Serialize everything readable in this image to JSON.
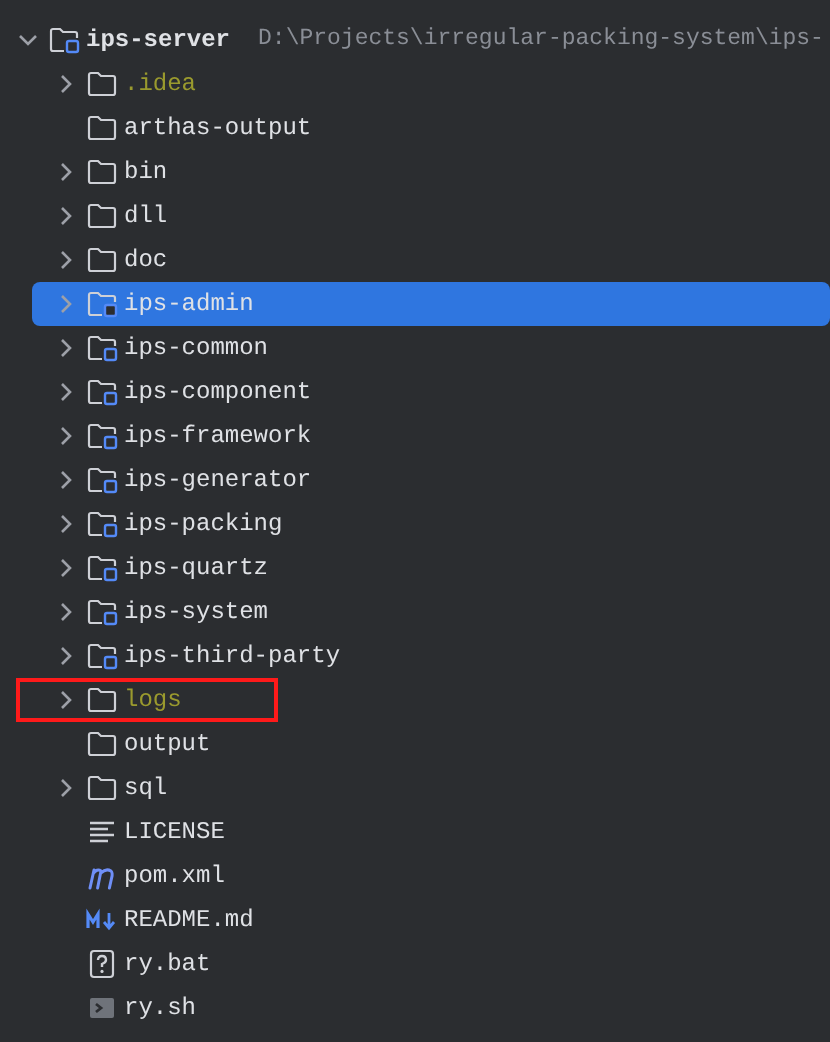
{
  "project_tree": {
    "name": "ips-server",
    "kind": "module",
    "path": "D:\\Projects\\irregular-packing-system\\ips-",
    "expanded": true,
    "children": [
      {
        "name": ".idea",
        "kind": "folder",
        "expandable": true,
        "excluded": true,
        "selected": false,
        "marked": false
      },
      {
        "name": "arthas-output",
        "kind": "folder",
        "expandable": false,
        "excluded": false,
        "selected": false,
        "marked": false
      },
      {
        "name": "bin",
        "kind": "folder",
        "expandable": true,
        "excluded": false,
        "selected": false,
        "marked": false
      },
      {
        "name": "dll",
        "kind": "folder",
        "expandable": true,
        "excluded": false,
        "selected": false,
        "marked": false
      },
      {
        "name": "doc",
        "kind": "folder",
        "expandable": true,
        "excluded": false,
        "selected": false,
        "marked": false
      },
      {
        "name": "ips-admin",
        "kind": "module",
        "expandable": true,
        "excluded": false,
        "selected": true,
        "marked": false
      },
      {
        "name": "ips-common",
        "kind": "module",
        "expandable": true,
        "excluded": false,
        "selected": false,
        "marked": false
      },
      {
        "name": "ips-component",
        "kind": "module",
        "expandable": true,
        "excluded": false,
        "selected": false,
        "marked": false
      },
      {
        "name": "ips-framework",
        "kind": "module",
        "expandable": true,
        "excluded": false,
        "selected": false,
        "marked": false
      },
      {
        "name": "ips-generator",
        "kind": "module",
        "expandable": true,
        "excluded": false,
        "selected": false,
        "marked": false
      },
      {
        "name": "ips-packing",
        "kind": "module",
        "expandable": true,
        "excluded": false,
        "selected": false,
        "marked": false
      },
      {
        "name": "ips-quartz",
        "kind": "module",
        "expandable": true,
        "excluded": false,
        "selected": false,
        "marked": false
      },
      {
        "name": "ips-system",
        "kind": "module",
        "expandable": true,
        "excluded": false,
        "selected": false,
        "marked": false
      },
      {
        "name": "ips-third-party",
        "kind": "module",
        "expandable": true,
        "excluded": false,
        "selected": false,
        "marked": false
      },
      {
        "name": "logs",
        "kind": "folder",
        "expandable": true,
        "excluded": true,
        "selected": false,
        "marked": true
      },
      {
        "name": "output",
        "kind": "folder",
        "expandable": false,
        "excluded": false,
        "selected": false,
        "marked": false
      },
      {
        "name": "sql",
        "kind": "folder",
        "expandable": true,
        "excluded": false,
        "selected": false,
        "marked": false
      },
      {
        "name": "LICENSE",
        "kind": "text",
        "expandable": false,
        "excluded": false,
        "selected": false,
        "marked": false
      },
      {
        "name": "pom.xml",
        "kind": "maven",
        "expandable": false,
        "excluded": false,
        "selected": false,
        "marked": false
      },
      {
        "name": "README.md",
        "kind": "markdown",
        "expandable": false,
        "excluded": false,
        "selected": false,
        "marked": false
      },
      {
        "name": "ry.bat",
        "kind": "unknown",
        "expandable": false,
        "excluded": false,
        "selected": false,
        "marked": false
      },
      {
        "name": "ry.sh",
        "kind": "shell",
        "expandable": false,
        "excluded": false,
        "selected": false,
        "marked": false
      }
    ]
  }
}
